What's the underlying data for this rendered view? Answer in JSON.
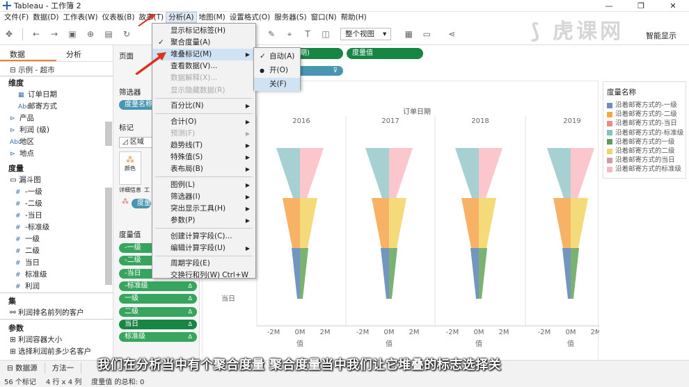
{
  "window": {
    "title": "Tableau - 工作簿 2",
    "controls": [
      "—",
      "❐",
      "✕"
    ]
  },
  "menubar": [
    {
      "label": "文件(F)"
    },
    {
      "label": "数据(D)"
    },
    {
      "label": "工作表(W)"
    },
    {
      "label": "仪表板(B)"
    },
    {
      "label": "故事(T)"
    },
    {
      "label": "分析(A)",
      "active": true
    },
    {
      "label": "地图(M)"
    },
    {
      "label": "设置格式(O)"
    },
    {
      "label": "服务器(S)"
    },
    {
      "label": "窗口(N)"
    },
    {
      "label": "帮助(H)"
    }
  ],
  "toolbar": {
    "view_select": "整个视图",
    "smart_show": "智能显示"
  },
  "left_pane": {
    "tabs": [
      "数据",
      "分析"
    ],
    "source": "示例 - 超市",
    "dimensions_head": "维度",
    "dimensions": [
      "订单日期",
      "邮寄方式",
      "产品",
      "利润 (级)",
      "地区",
      "地点"
    ],
    "measures_head": "度量",
    "measures_group": "漏斗图",
    "measures": [
      "-一级",
      "-二级",
      "-当日",
      "-标准级",
      "一级",
      "二级",
      "当日",
      "标准级",
      "利润"
    ],
    "sets_head": "集",
    "sets": [
      "利润排名前列的客户"
    ],
    "params_head": "参数",
    "params": [
      "利润容器大小",
      "选择利润前多少名客户"
    ]
  },
  "cards": {
    "pages": "页面",
    "filters": "筛选器",
    "filter_pill": "度量名称",
    "marks": "标记",
    "mark_type": "区域",
    "mark_btns": [
      "颜色",
      "详细信息",
      "工"
    ],
    "marks_pill": "度量",
    "measure_values": "度量值",
    "mv_pills": [
      "-一级",
      "-二级",
      "-当日",
      "-标准级",
      "一级",
      "二级",
      "当日",
      "标准级"
    ]
  },
  "shelves": {
    "columns_pill": "日期",
    "rows_pill": "度量值"
  },
  "analysis_menu": {
    "items": [
      {
        "label": "显示标记标签(H)"
      },
      {
        "label": "聚合度量(A)",
        "checked": true
      },
      {
        "label": "堆叠标记(M)",
        "submenu": true,
        "highlight": true
      },
      {
        "label": "查看数据(V)..."
      },
      {
        "label": "数据解释(X)...",
        "disabled": true
      },
      {
        "label": "显示隐藏数据(R)",
        "disabled": true
      },
      {
        "label": "百分比(N)",
        "submenu": true
      },
      {
        "label": "合计(O)",
        "submenu": true
      },
      {
        "label": "预测(F)",
        "submenu": true,
        "disabled": true
      },
      {
        "label": "趋势线(T)",
        "submenu": true
      },
      {
        "label": "特殊值(S)",
        "submenu": true
      },
      {
        "label": "表布局(B)",
        "submenu": true
      },
      {
        "label": "图例(L)",
        "submenu": true
      },
      {
        "label": "筛选器(I)",
        "submenu": true
      },
      {
        "label": "突出显示工具(H)",
        "submenu": true
      },
      {
        "label": "参数(P)",
        "submenu": true
      },
      {
        "label": "创建计算字段(C)..."
      },
      {
        "label": "编辑计算字段(U)",
        "submenu": true
      },
      {
        "label": "周期字段(E)"
      },
      {
        "label": "交换行和列(W)",
        "accel": "Ctrl+W"
      }
    ]
  },
  "stack_submenu": {
    "items": [
      {
        "label": "自动(A)",
        "mark": "check"
      },
      {
        "label": "开(O)",
        "mark": "dot"
      },
      {
        "label": "关(F)",
        "highlight": true
      }
    ]
  },
  "chart_data": {
    "type": "area",
    "title": "",
    "column_header": "订单日期",
    "years": [
      "2016",
      "2017",
      "2018",
      "2019"
    ],
    "x_ticks": [
      "-2M",
      "0M",
      "2M"
    ],
    "x_axis_label": "值",
    "row_label": "当日",
    "layers": [
      "标准级",
      "二级",
      "一级"
    ],
    "legend_title": "度量名称",
    "legend": [
      {
        "name": "沿着邮寄方式的-一级",
        "color": "#6f8fb8"
      },
      {
        "name": "沿着邮寄方式的-二级",
        "color": "#f4a84a"
      },
      {
        "name": "沿着邮寄方式的-当日",
        "color": "#f08a80"
      },
      {
        "name": "沿着邮寄方式的-标准级",
        "color": "#86bfc2"
      },
      {
        "name": "沿着邮寄方式的一级",
        "color": "#5f9c5a"
      },
      {
        "name": "沿着邮寄方式的二级",
        "color": "#f2d36b"
      },
      {
        "name": "沿着邮寄方式的当日",
        "color": "#d19aa8"
      },
      {
        "name": "沿着邮寄方式的标准级",
        "color": "#f7b9c0"
      }
    ],
    "colors": {
      "neg_std": "#a6d0d1",
      "pos_std": "#fbc6cc",
      "neg_l2": "#f7b266",
      "pos_l2": "#f5da7a",
      "neg_l1": "#7396c0",
      "pos_l1": "#7cb271"
    }
  },
  "sheet_tabs": [
    "数据源",
    "方法一"
  ],
  "status": {
    "marks": "56 个标记",
    "rows_cols": "4 行 x 4 列",
    "sum": "度量值 的总和: 0"
  },
  "subtitle": "我们在分析当中有个聚合度量 聚合度量当中我们让它堆叠的标志选择关",
  "watermark": "虎课网"
}
